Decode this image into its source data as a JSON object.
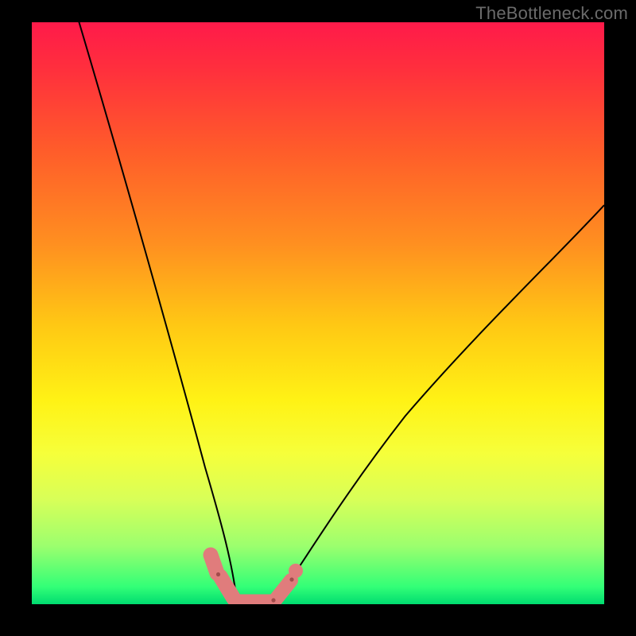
{
  "watermark": "TheBottleneck.com",
  "colors": {
    "background": "#000000",
    "gradient_top": "#ff1a4a",
    "gradient_bottom": "#00dc70",
    "curve": "#000000",
    "marker": "#e07c7c"
  },
  "chart_data": {
    "type": "line",
    "title": "",
    "xlabel": "",
    "ylabel": "",
    "xlim": [
      0,
      100
    ],
    "ylim": [
      0,
      100
    ],
    "grid": false,
    "legend": false,
    "series": [
      {
        "name": "left",
        "x": [
          8,
          12,
          16,
          20,
          24,
          27,
          29.5,
          31.5,
          33,
          34.5,
          35.6
        ],
        "y": [
          100,
          84,
          68,
          52,
          36,
          22,
          12,
          6,
          2.5,
          0.8,
          0.2
        ]
      },
      {
        "name": "bottom",
        "x": [
          35.6,
          37,
          39,
          41,
          42.5
        ],
        "y": [
          0.2,
          0,
          0,
          0,
          0.2
        ]
      },
      {
        "name": "right",
        "x": [
          42.5,
          44,
          47,
          52,
          60,
          70,
          82,
          94,
          100
        ],
        "y": [
          0.2,
          1.2,
          4.5,
          11,
          23,
          37,
          51,
          63,
          69
        ]
      }
    ],
    "markers_left": {
      "x": [
        31.3,
        32.2,
        33.1,
        34.0,
        34.9,
        35.6
      ],
      "y": [
        7.5,
        5.5,
        3.8,
        2.4,
        1.2,
        0.4
      ]
    },
    "markers_bottom": {
      "x": [
        36.5,
        37.7,
        39.0,
        40.3,
        41.5
      ],
      "y": [
        0.1,
        0,
        0,
        0,
        0.1
      ]
    },
    "markers_right": {
      "x": [
        43.2,
        43.8,
        44.7,
        45.8
      ],
      "y": [
        0.8,
        1.4,
        2.4,
        4.2
      ]
    }
  }
}
